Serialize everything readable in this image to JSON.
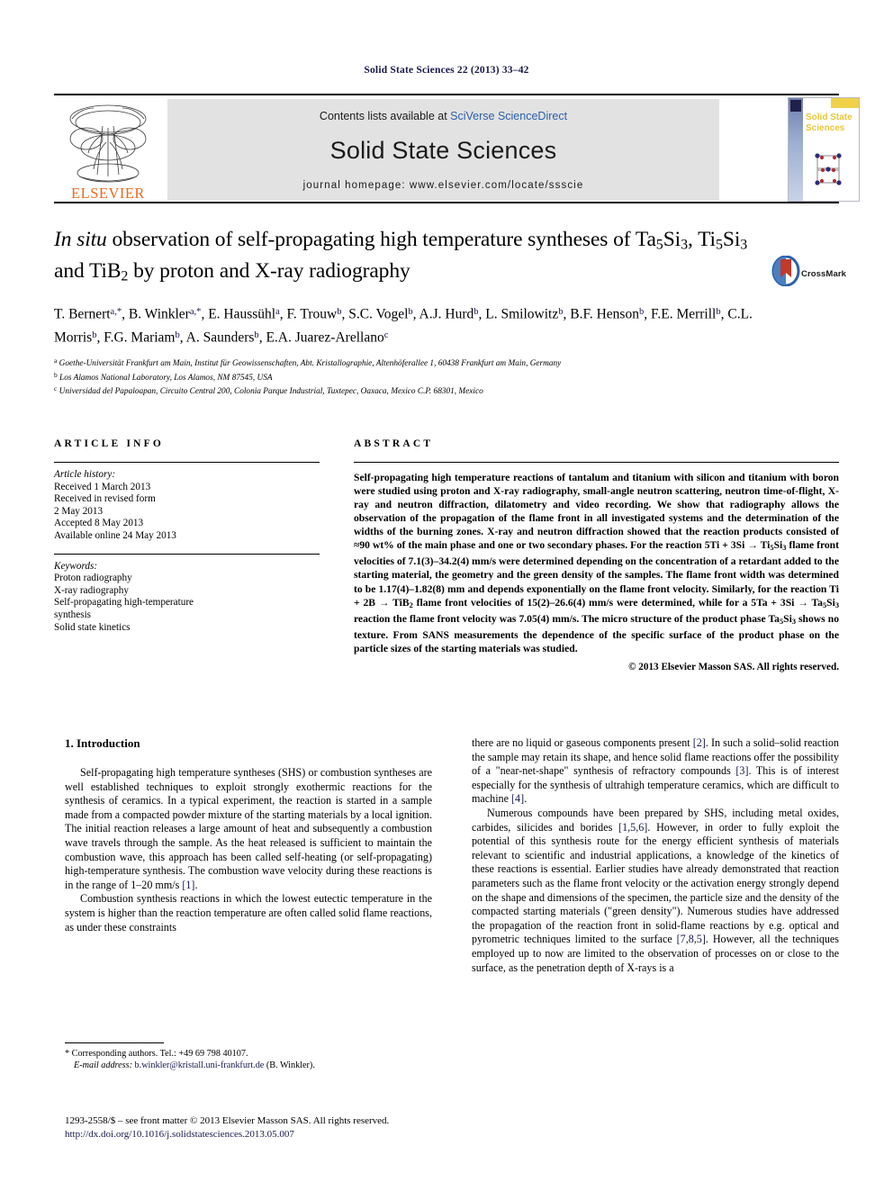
{
  "running_head": "Solid State Sciences 22 (2013) 33–42",
  "masthead": {
    "publisher_logo_text": "ELSEVIER",
    "contents_prefix": "Contents lists available at ",
    "contents_link": "SciVerse ScienceDirect",
    "journal_title": "Solid State Sciences",
    "homepage_line": "journal homepage: www.elsevier.com/locate/ssscie",
    "cover_title": "Solid State Sciences"
  },
  "article": {
    "title_part1_italic": "In situ",
    "title_rest": " observation of self-propagating high temperature syntheses of Ta5Si3, Ti5Si3 and TiB2 by proton and X-ray radiography",
    "crossmark_label": "CrossMark",
    "authors": "T. Bernert a,*, B. Winkler a,*, E. Haussühl a, F. Trouw b, S.C. Vogel b, A.J. Hurd b, L. Smilowitz b, B.F. Henson b, F.E. Merrill b, C.L. Morris b, F.G. Mariam b, A. Saunders b, E.A. Juarez-Arellano c",
    "affiliations": [
      "a Goethe-Universität Frankfurt am Main, Institut für Geowissenschaften, Abt. Kristallographie, Altenhöferallee 1, 60438 Frankfurt am Main, Germany",
      "b Los Alamos National Laboratory, Los Alamos, NM 87545, USA",
      "c Universidad del Papaloapan, Circuito Central 200, Colonia Parque Industrial, Tuxtepec, Oaxaca, Mexico C.P. 68301, Mexico"
    ]
  },
  "article_info": {
    "heading": "ARTICLE INFO",
    "history_label": "Article history:",
    "history_lines": [
      "Received 1 March 2013",
      "Received in revised form",
      "2 May 2013",
      "Accepted 8 May 2013",
      "Available online 24 May 2013"
    ],
    "keywords_label": "Keywords:",
    "keywords": [
      "Proton radiography",
      "X-ray radiography",
      "Self-propagating high-temperature",
      "synthesis",
      "Solid state kinetics"
    ]
  },
  "abstract": {
    "heading": "ABSTRACT",
    "text": "Self-propagating high temperature reactions of tantalum and titanium with silicon and titanium with boron were studied using proton and X-ray radiography, small-angle neutron scattering, neutron time-of-flight, X-ray and neutron diffraction, dilatometry and video recording. We show that radiography allows the observation of the propagation of the flame front in all investigated systems and the determination of the widths of the burning zones. X-ray and neutron diffraction showed that the reaction products consisted of ≈90 wt% of the main phase and one or two secondary phases. For the reaction 5Ti + 3Si → Ti5Si3 flame front velocities of 7.1(3)–34.2(4) mm/s were determined depending on the concentration of a retardant added to the starting material, the geometry and the green density of the samples. The flame front width was determined to be 1.17(4)–1.82(8) mm and depends exponentially on the flame front velocity. Similarly, for the reaction Ti + 2B → TiB2 flame front velocities of 15(2)–26.6(4) mm/s were determined, while for a 5Ta + 3Si → Ta5Si3 reaction the flame front velocity was 7.05(4) mm/s. The micro structure of the product phase Ta5Si3 shows no texture. From SANS measurements the dependence of the specific surface of the product phase on the particle sizes of the starting materials was studied.",
    "copyright": "© 2013 Elsevier Masson SAS. All rights reserved."
  },
  "body": {
    "section_heading": "1. Introduction",
    "left_paragraphs": [
      "Self-propagating high temperature syntheses (SHS) or combustion syntheses are well established techniques to exploit strongly exothermic reactions for the synthesis of ceramics. In a typical experiment, the reaction is started in a sample made from a compacted powder mixture of the starting materials by a local ignition. The initial reaction releases a large amount of heat and subsequently a combustion wave travels through the sample. As the heat released is sufficient to maintain the combustion wave, this approach has been called self-heating (or self-propagating) high-temperature synthesis. The combustion wave velocity during these reactions is in the range of 1–20 mm/s [1].",
      "Combustion synthesis reactions in which the lowest eutectic temperature in the system is higher than the reaction temperature are often called solid flame reactions, as under these constraints"
    ],
    "right_paragraphs": [
      "there are no liquid or gaseous components present [2]. In such a solid–solid reaction the sample may retain its shape, and hence solid flame reactions offer the possibility of a \"near-net-shape\" synthesis of refractory compounds [3]. This is of interest especially for the synthesis of ultrahigh temperature ceramics, which are difficult to machine [4].",
      "Numerous compounds have been prepared by SHS, including metal oxides, carbides, silicides and borides [1,5,6]. However, in order to fully exploit the potential of this synthesis route for the energy efficient synthesis of materials relevant to scientific and industrial applications, a knowledge of the kinetics of these reactions is essential. Earlier studies have already demonstrated that reaction parameters such as the flame front velocity or the activation energy strongly depend on the shape and dimensions of the specimen, the particle size and the density of the compacted starting materials (\"green density\"). Numerous studies have addressed the propagation of the reaction front in solid-flame reactions by e.g. optical and pyrometric techniques limited to the surface [7,8,5]. However, all the techniques employed up to now are limited to the observation of processes on or close to the surface, as the penetration depth of X-rays is a"
    ]
  },
  "footnote": {
    "corresponding": "* Corresponding authors. Tel.: +49 69 798 40107.",
    "email_label": "E-mail address:",
    "email": "b.winkler@kristall.uni-frankfurt.de",
    "email_suffix": "(B. Winkler)."
  },
  "colophon": {
    "front_matter": "1293-2558/$ – see front matter © 2013 Elsevier Masson SAS. All rights reserved.",
    "doi": "http://dx.doi.org/10.1016/j.solidstatesciences.2013.05.007"
  },
  "colors": {
    "link_blue": "#17184b",
    "sciencedirect_blue": "#2b5fa8",
    "elsevier_orange": "#e86c24",
    "band_gray": "#e2e2e2",
    "crossmark_red": "#c0392b"
  }
}
